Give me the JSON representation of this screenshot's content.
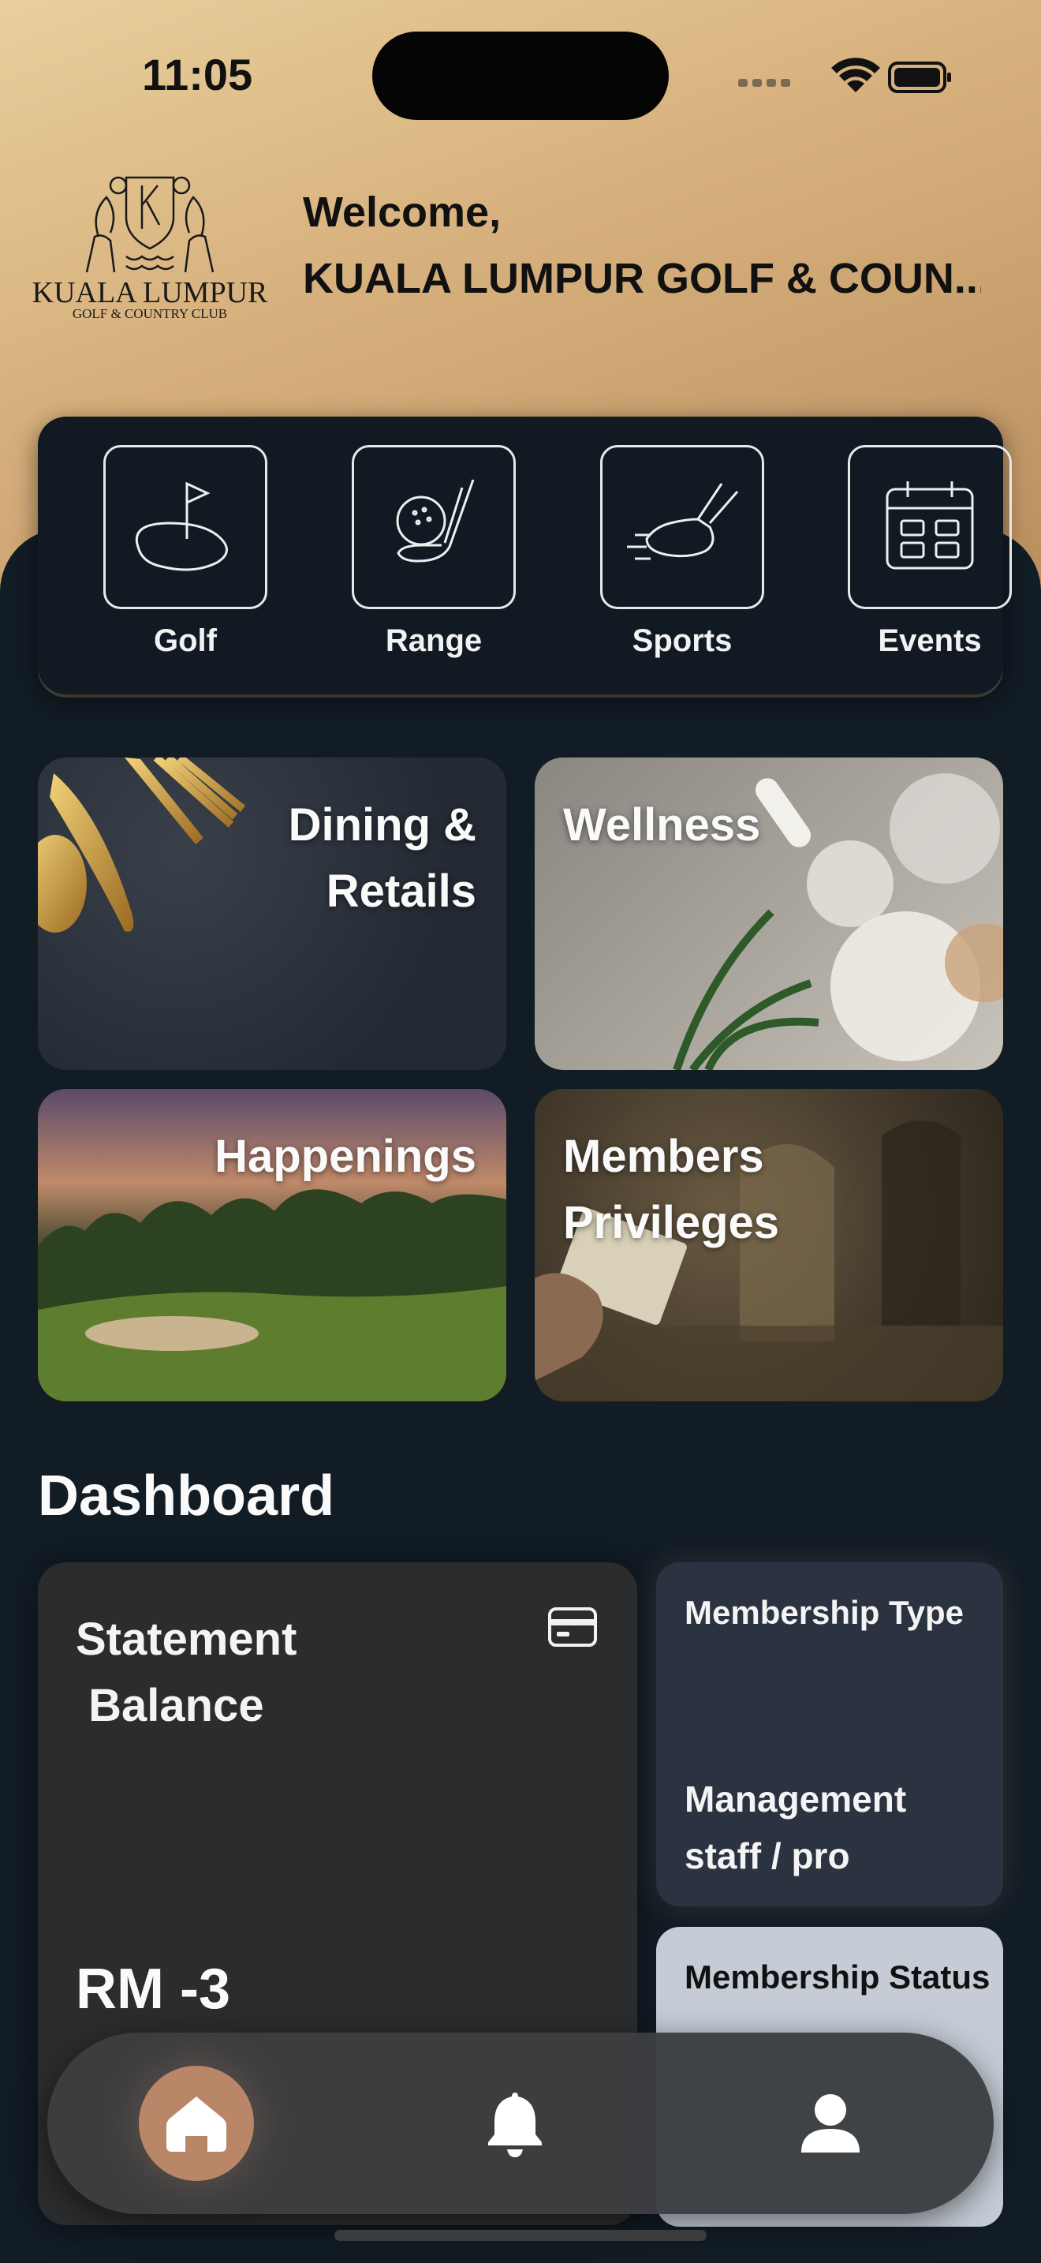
{
  "status_bar": {
    "time": "11:05"
  },
  "header": {
    "logo": {
      "name": "KUALA LUMPUR",
      "subtitle": "GOLF & COUNTRY CLUB"
    },
    "welcome": "Welcome,",
    "club_name": "KUALA LUMPUR GOLF & COUN..."
  },
  "quick_actions": [
    {
      "label": "Golf",
      "icon": "golf-flag-icon"
    },
    {
      "label": "Range",
      "icon": "golf-club-ball-icon"
    },
    {
      "label": "Sports",
      "icon": "running-shoe-icon"
    },
    {
      "label": "Events",
      "icon": "calendar-icon"
    }
  ],
  "tiles": [
    {
      "title_line1": "Dining &",
      "title_line2": "Retails"
    },
    {
      "title_line1": "Wellness",
      "title_line2": ""
    },
    {
      "title_line1": "Happenings",
      "title_line2": ""
    },
    {
      "title_line1": "Members",
      "title_line2": "Privileges"
    }
  ],
  "dashboard": {
    "title": "Dashboard",
    "statement": {
      "title_line1": "Statement",
      "title_line2": " Balance",
      "amount": "RM -3",
      "icon": "credit-card-icon"
    },
    "membership_type": {
      "label": "Membership Type",
      "value_line1": "Management",
      "value_line2": "staff / pro"
    },
    "membership_status": {
      "label": "Membership Status"
    }
  },
  "bottom_nav": [
    {
      "name": "home",
      "icon": "home-icon",
      "active": true
    },
    {
      "name": "notifications",
      "icon": "bell-icon",
      "active": false
    },
    {
      "name": "profile",
      "icon": "user-icon",
      "active": false
    }
  ],
  "colors": {
    "header_gold": "#d8b27e",
    "panel_dark": "#121c25",
    "accent_copper": "#b98768",
    "membership_status_bg": "#c5ccd6"
  }
}
